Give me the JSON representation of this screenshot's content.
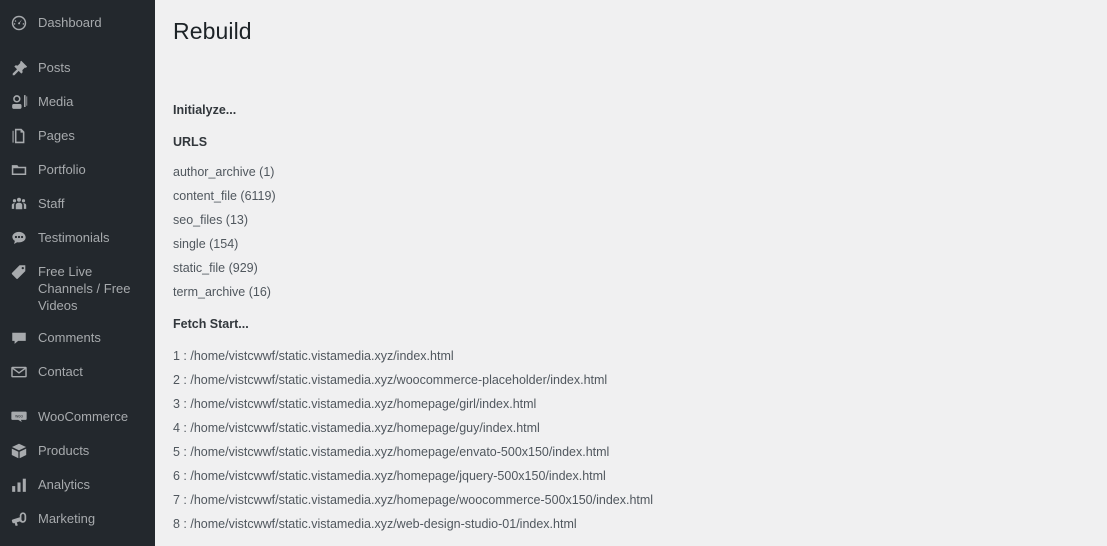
{
  "sidebar": {
    "groups": [
      {
        "items": [
          {
            "label": "Dashboard",
            "icon": "dashboard-gauge-icon",
            "name": "dashboard"
          }
        ]
      },
      {
        "items": [
          {
            "label": "Posts",
            "icon": "pin-icon",
            "name": "posts"
          },
          {
            "label": "Media",
            "icon": "media-icon",
            "name": "media"
          },
          {
            "label": "Pages",
            "icon": "pages-icon",
            "name": "pages"
          },
          {
            "label": "Portfolio",
            "icon": "portfolio-folder-icon",
            "name": "portfolio"
          },
          {
            "label": "Staff",
            "icon": "staff-group-icon",
            "name": "staff"
          },
          {
            "label": "Testimonials",
            "icon": "testimonials-bubble-icon",
            "name": "testimonials"
          },
          {
            "label": "Free Live Channels / Free Videos",
            "icon": "tag-icon",
            "name": "free-live-channels",
            "two_line": true
          },
          {
            "label": "Comments",
            "icon": "comments-bubble-icon",
            "name": "comments"
          },
          {
            "label": "Contact",
            "icon": "envelope-icon",
            "name": "contact"
          }
        ]
      },
      {
        "items": [
          {
            "label": "WooCommerce",
            "icon": "woocommerce-icon",
            "name": "woocommerce"
          },
          {
            "label": "Products",
            "icon": "products-box-icon",
            "name": "products"
          },
          {
            "label": "Analytics",
            "icon": "analytics-bars-icon",
            "name": "analytics"
          },
          {
            "label": "Marketing",
            "icon": "marketing-megaphone-icon",
            "name": "marketing"
          }
        ]
      }
    ]
  },
  "main": {
    "page_title": "Rebuild",
    "initialize_label": "Initialyze...",
    "urls_heading": "URLS",
    "url_counts": [
      "author_archive (1)",
      "content_file (6119)",
      "seo_files (13)",
      "single (154)",
      "static_file (929)",
      "term_archive (16)"
    ],
    "fetch_start_label": "Fetch Start...",
    "paths": [
      "1 : /home/vistcwwf/static.vistamedia.xyz/index.html",
      "2 : /home/vistcwwf/static.vistamedia.xyz/woocommerce-placeholder/index.html",
      "3 : /home/vistcwwf/static.vistamedia.xyz/homepage/girl/index.html",
      "4 : /home/vistcwwf/static.vistamedia.xyz/homepage/guy/index.html",
      "5 : /home/vistcwwf/static.vistamedia.xyz/homepage/envato-500x150/index.html",
      "6 : /home/vistcwwf/static.vistamedia.xyz/homepage/jquery-500x150/index.html",
      "7 : /home/vistcwwf/static.vistamedia.xyz/homepage/woocommerce-500x150/index.html",
      "8 : /home/vistcwwf/static.vistamedia.xyz/web-design-studio-01/index.html"
    ]
  },
  "colors": {
    "sidebar_bg": "#23282d",
    "sidebar_text": "#a7aaad",
    "content_bg": "#f0f0f1",
    "heading_text": "#1d2327",
    "body_text": "#50575e"
  }
}
